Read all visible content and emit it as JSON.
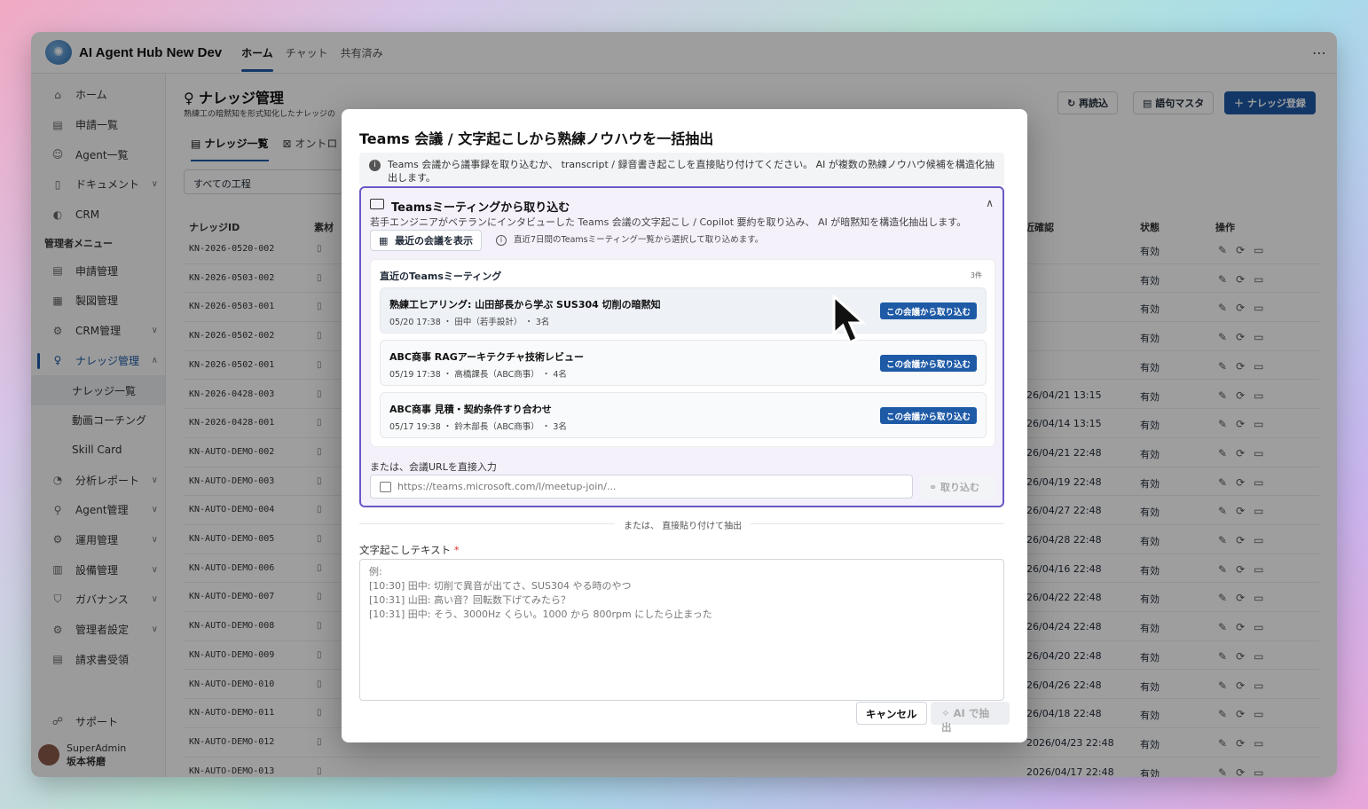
{
  "app": {
    "title": "AI Agent Hub New Dev",
    "tabs": [
      "ホーム",
      "チャット",
      "共有済み"
    ]
  },
  "sidebar": {
    "items": [
      {
        "label": "ホーム",
        "icon": "home-icon"
      },
      {
        "label": "申請一覧",
        "icon": "document-user-icon"
      },
      {
        "label": "Agent一覧",
        "icon": "agent-icon"
      },
      {
        "label": "ドキュメント",
        "icon": "file-icon"
      },
      {
        "label": "CRM",
        "icon": "crm-icon"
      }
    ],
    "admin_group": "管理者メニュー",
    "admin_items": [
      {
        "label": "申請管理"
      },
      {
        "label": "製図管理"
      },
      {
        "label": "CRM管理"
      },
      {
        "label": "ナレッジ管理"
      },
      {
        "label": "ナレッジ一覧"
      },
      {
        "label": "動画コーチング"
      },
      {
        "label": "Skill Card"
      },
      {
        "label": "分析レポート"
      },
      {
        "label": "Agent管理"
      },
      {
        "label": "運用管理"
      },
      {
        "label": "設備管理"
      },
      {
        "label": "ガバナンス"
      },
      {
        "label": "管理者設定"
      },
      {
        "label": "請求書受領"
      }
    ],
    "support": "サポート",
    "user": {
      "name": "SuperAdmin",
      "sub": "坂本将磨"
    }
  },
  "page": {
    "title": "ナレッジ管理",
    "subtitle": "熟練工の暗黙知を形式知化したナレッジの",
    "reload": "再読込",
    "terms": "語句マスタ",
    "register": "ナレッジ登録",
    "tabs": [
      "ナレッジ一覧",
      "オントロ"
    ],
    "filter": "すべての工程",
    "columns": {
      "id": "ナレッジID",
      "material": "素材",
      "confirmed": "近確認",
      "status": "状態",
      "ops": "操作"
    }
  },
  "rows": [
    {
      "id": "KN-2026-0520-002",
      "date": "",
      "status": "有効"
    },
    {
      "id": "KN-2026-0503-002",
      "date": "",
      "status": "有効"
    },
    {
      "id": "KN-2026-0503-001",
      "date": "",
      "status": "有効"
    },
    {
      "id": "KN-2026-0502-002",
      "date": "",
      "status": "有効"
    },
    {
      "id": "KN-2026-0502-001",
      "date": "",
      "status": "有効"
    },
    {
      "id": "KN-2026-0428-003",
      "date": "26/04/21 13:15",
      "status": "有効"
    },
    {
      "id": "KN-2026-0428-001",
      "date": "26/04/14 13:15",
      "status": "有効"
    },
    {
      "id": "KN-AUTO-DEMO-002",
      "date": "26/04/21 22:48",
      "status": "有効"
    },
    {
      "id": "KN-AUTO-DEMO-003",
      "date": "26/04/19 22:48",
      "status": "有効"
    },
    {
      "id": "KN-AUTO-DEMO-004",
      "date": "26/04/27 22:48",
      "status": "有効"
    },
    {
      "id": "KN-AUTO-DEMO-005",
      "date": "26/04/28 22:48",
      "status": "有効"
    },
    {
      "id": "KN-AUTO-DEMO-006",
      "date": "26/04/16 22:48",
      "status": "有効"
    },
    {
      "id": "KN-AUTO-DEMO-007",
      "date": "26/04/22 22:48",
      "status": "有効"
    },
    {
      "id": "KN-AUTO-DEMO-008",
      "date": "26/04/24 22:48",
      "status": "有効"
    },
    {
      "id": "KN-AUTO-DEMO-009",
      "date": "26/04/20 22:48",
      "status": "有効"
    },
    {
      "id": "KN-AUTO-DEMO-010",
      "date": "26/04/26 22:48",
      "status": "有効"
    },
    {
      "id": "KN-AUTO-DEMO-011",
      "date": "26/04/18 22:48",
      "status": "有効"
    },
    {
      "id": "KN-AUTO-DEMO-012",
      "date": "2026/04/23 22:48",
      "status": "有効"
    },
    {
      "id": "KN-AUTO-DEMO-013",
      "date": "2026/04/17 22:48",
      "status": "有効"
    }
  ],
  "modal": {
    "title": "Teams 会議 / 文字起こしから熟練ノウハウを一括抽出",
    "info": "Teams 会議から議事録を取り込むか、 transcript / 録音書き起こしを直接貼り付けてください。 AI が複数の熟練ノウハウ候補を構造化抽出します。",
    "teams_title": "Teamsミーティングから取り込む",
    "teams_desc": "若手エンジニアがベテランにインタビューした Teams 会議の文字起こし / Copilot 要約を取り込み、 AI が暗黙知を構造化抽出します。",
    "show_recent": "最近の会議を表示",
    "hint": "直近7日間のTeamsミーティング一覧から選択して取り込めます。",
    "list_title": "直近のTeamsミーティング",
    "list_count": "3件",
    "meetings": [
      {
        "title": "熟練工ヒアリング: 山田部長から学ぶ SUS304 切削の暗黙知",
        "meta": "05/20 17:38 ・ 田中（若手設計） ・ 3名",
        "button": "この会議から取り込む"
      },
      {
        "title": "ABC商事 RAGアーキテクチャ技術レビュー",
        "meta": "05/19 17:38 ・ 高橋課長（ABC商事） ・ 4名",
        "button": "この会議から取り込む"
      },
      {
        "title": "ABC商事 見積・契約条件すり合わせ",
        "meta": "05/17 19:38 ・ 鈴木部長（ABC商事） ・ 3名",
        "button": "この会議から取り込む"
      }
    ],
    "url_label": "または、会議URLを直接入力",
    "url_placeholder": "https://teams.microsoft.com/l/meetup-join/...",
    "url_button": "取り込む",
    "divider": "または、 直接貼り付けて抽出",
    "text_label": "文字起こしテキスト",
    "required": "*",
    "textarea_placeholder": "例:\n[10:30] 田中: 切削で異音が出てさ、SUS304 やる時のやつ\n[10:31] 山田: 高い音？回転数下げてみたら？\n[10:31] 田中: そう、3000Hz くらい。1000 から 800rpm にしたら止まった",
    "cancel": "キャンセル",
    "extract": "AI で抽出"
  }
}
